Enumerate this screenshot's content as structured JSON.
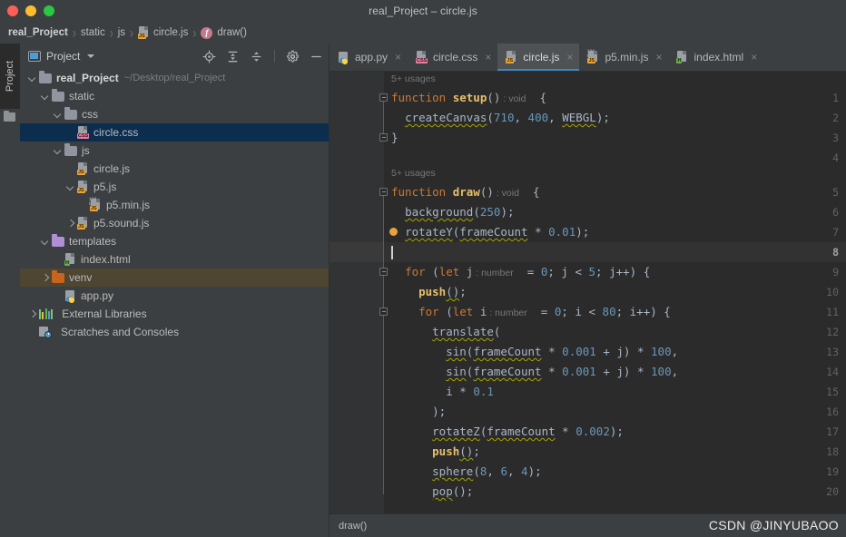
{
  "window": {
    "title": "real_Project – circle.js",
    "traffic_lights": [
      "close",
      "minimize",
      "maximize"
    ]
  },
  "breadcrumb": {
    "separator": "›",
    "items": [
      {
        "label": "real_Project",
        "bold": true,
        "icon": ""
      },
      {
        "label": "static",
        "bold": false,
        "icon": ""
      },
      {
        "label": "js",
        "bold": false,
        "icon": ""
      },
      {
        "label": "circle.js",
        "bold": false,
        "icon": "js-file-icon"
      },
      {
        "label": "draw()",
        "bold": false,
        "icon": "function-badge-icon"
      }
    ]
  },
  "left_strip": {
    "vertical_tab_label": "Project",
    "folder_icon": "folder-icon"
  },
  "project_panel": {
    "title": "Project",
    "title_icon": "project-view-icon",
    "dropdown_icon": "chevron-down-icon",
    "toolbar_icons": [
      "select-opened-file-icon",
      "expand-all-icon",
      "collapse-all-icon",
      "settings-gear-icon",
      "hide-panel-icon"
    ],
    "tree": [
      {
        "depth": 0,
        "chevron": "down",
        "icon": "folder-gray",
        "label": "real_Project",
        "bold": true,
        "path": "~/Desktop/real_Project",
        "state": "normal"
      },
      {
        "depth": 1,
        "chevron": "down",
        "icon": "folder-gray",
        "label": "static",
        "bold": false,
        "path": "",
        "state": "normal"
      },
      {
        "depth": 2,
        "chevron": "down",
        "icon": "folder-gray",
        "label": "css",
        "bold": false,
        "path": "",
        "state": "normal"
      },
      {
        "depth": 3,
        "chevron": "none",
        "icon": "file-css",
        "label": "circle.css",
        "bold": false,
        "path": "",
        "state": "selected"
      },
      {
        "depth": 2,
        "chevron": "down",
        "icon": "folder-gray",
        "label": "js",
        "bold": false,
        "path": "",
        "state": "normal"
      },
      {
        "depth": 3,
        "chevron": "none",
        "icon": "file-js",
        "label": "circle.js",
        "bold": false,
        "path": "",
        "state": "normal"
      },
      {
        "depth": 3,
        "chevron": "down",
        "icon": "file-js",
        "label": "p5.js",
        "bold": false,
        "path": "",
        "state": "normal"
      },
      {
        "depth": 4,
        "chevron": "none",
        "icon": "file-minjs",
        "label": "p5.min.js",
        "bold": false,
        "path": "",
        "state": "normal"
      },
      {
        "depth": 3,
        "chevron": "right",
        "icon": "file-js",
        "label": "p5.sound.js",
        "bold": false,
        "path": "",
        "state": "normal"
      },
      {
        "depth": 1,
        "chevron": "down",
        "icon": "folder-purple",
        "label": "templates",
        "bold": false,
        "path": "",
        "state": "normal"
      },
      {
        "depth": 2,
        "chevron": "none",
        "icon": "file-html",
        "label": "index.html",
        "bold": false,
        "path": "",
        "state": "normal"
      },
      {
        "depth": 1,
        "chevron": "right",
        "icon": "folder-orange",
        "label": "venv",
        "bold": false,
        "path": "",
        "state": "selected-inactive"
      },
      {
        "depth": 2,
        "chevron": "none",
        "icon": "file-python",
        "label": "app.py",
        "bold": false,
        "path": "",
        "state": "normal"
      },
      {
        "depth": 0,
        "chevron": "right",
        "icon": "external-libraries",
        "label": "External Libraries",
        "bold": false,
        "path": "",
        "state": "normal"
      },
      {
        "depth": 0,
        "chevron": "none",
        "icon": "scratches",
        "label": "Scratches and Consoles",
        "bold": false,
        "path": "",
        "state": "normal"
      }
    ]
  },
  "editor": {
    "tabs": [
      {
        "label": "app.py",
        "icon": "python-file-icon",
        "active": false,
        "close_icon": "×"
      },
      {
        "label": "circle.css",
        "icon": "css-file-icon",
        "active": false,
        "close_icon": "×"
      },
      {
        "label": "circle.js",
        "icon": "js-file-icon",
        "active": true,
        "close_icon": "×"
      },
      {
        "label": "p5.min.js",
        "icon": "minjs-file-icon",
        "active": false,
        "close_icon": "×"
      },
      {
        "label": "index.html",
        "icon": "html-file-icon",
        "active": false,
        "close_icon": "×"
      }
    ],
    "usage_hints": [
      {
        "text": "5+ usages",
        "above_line": 1
      },
      {
        "text": "5+ usages",
        "above_line": 5
      }
    ],
    "current_line": 8,
    "breakpoint_line": 7,
    "line_numbers": [
      1,
      2,
      3,
      4,
      5,
      6,
      7,
      8,
      9,
      10,
      11,
      12,
      13,
      14,
      15,
      16,
      17,
      18,
      19,
      20
    ],
    "code": [
      {
        "n": 1,
        "tokens": [
          {
            "t": "function ",
            "c": "kw"
          },
          {
            "t": "setup",
            "c": "fname"
          },
          {
            "t": "()",
            "c": "id"
          },
          {
            "t": " : void",
            "c": "hint"
          },
          {
            "t": "  {",
            "c": "id"
          }
        ]
      },
      {
        "n": 2,
        "tokens": [
          {
            "t": "  ",
            "c": "id"
          },
          {
            "t": "createCanvas",
            "c": "sq"
          },
          {
            "t": "(",
            "c": "id"
          },
          {
            "t": "710",
            "c": "num"
          },
          {
            "t": ", ",
            "c": "id"
          },
          {
            "t": "400",
            "c": "num"
          },
          {
            "t": ", ",
            "c": "id"
          },
          {
            "t": "WEBGL",
            "c": "sq"
          },
          {
            "t": ");",
            "c": "id"
          }
        ]
      },
      {
        "n": 3,
        "tokens": [
          {
            "t": "}",
            "c": "id"
          }
        ]
      },
      {
        "n": 4,
        "tokens": []
      },
      {
        "n": 5,
        "tokens": [
          {
            "t": "function ",
            "c": "kw"
          },
          {
            "t": "draw",
            "c": "fname"
          },
          {
            "t": "()",
            "c": "id"
          },
          {
            "t": " : void",
            "c": "hint"
          },
          {
            "t": "  {",
            "c": "id"
          }
        ]
      },
      {
        "n": 6,
        "tokens": [
          {
            "t": "  ",
            "c": "id"
          },
          {
            "t": "background",
            "c": "sq"
          },
          {
            "t": "(",
            "c": "id"
          },
          {
            "t": "250",
            "c": "num"
          },
          {
            "t": ");",
            "c": "id"
          }
        ]
      },
      {
        "n": 7,
        "tokens": [
          {
            "t": "  ",
            "c": "id"
          },
          {
            "t": "rotateY",
            "c": "sq"
          },
          {
            "t": "(",
            "c": "id"
          },
          {
            "t": "frameCount",
            "c": "sq"
          },
          {
            "t": " * ",
            "c": "id"
          },
          {
            "t": "0.01",
            "c": "num"
          },
          {
            "t": ");",
            "c": "id"
          }
        ]
      },
      {
        "n": 8,
        "tokens": []
      },
      {
        "n": 9,
        "tokens": [
          {
            "t": "  ",
            "c": "id"
          },
          {
            "t": "for ",
            "c": "kw"
          },
          {
            "t": "(",
            "c": "id"
          },
          {
            "t": "let",
            "c": "kw"
          },
          {
            "t": " j",
            "c": "id"
          },
          {
            "t": " : number",
            "c": "hint"
          },
          {
            "t": "  = ",
            "c": "id"
          },
          {
            "t": "0",
            "c": "num"
          },
          {
            "t": "; j < ",
            "c": "id"
          },
          {
            "t": "5",
            "c": "num"
          },
          {
            "t": "; j++) {",
            "c": "id"
          }
        ]
      },
      {
        "n": 10,
        "tokens": [
          {
            "t": "    ",
            "c": "id"
          },
          {
            "t": "push",
            "c": "fname"
          },
          {
            "t": "()",
            "c": "sq"
          },
          {
            "t": ";",
            "c": "id"
          }
        ]
      },
      {
        "n": 11,
        "tokens": [
          {
            "t": "    ",
            "c": "id"
          },
          {
            "t": "for ",
            "c": "kw"
          },
          {
            "t": "(",
            "c": "id"
          },
          {
            "t": "let",
            "c": "kw"
          },
          {
            "t": " i",
            "c": "id"
          },
          {
            "t": " : number",
            "c": "hint"
          },
          {
            "t": "  = ",
            "c": "id"
          },
          {
            "t": "0",
            "c": "num"
          },
          {
            "t": "; i < ",
            "c": "id"
          },
          {
            "t": "80",
            "c": "num"
          },
          {
            "t": "; i++) {",
            "c": "id"
          }
        ]
      },
      {
        "n": 12,
        "tokens": [
          {
            "t": "      ",
            "c": "id"
          },
          {
            "t": "translate",
            "c": "sq"
          },
          {
            "t": "(",
            "c": "id"
          }
        ]
      },
      {
        "n": 13,
        "tokens": [
          {
            "t": "        ",
            "c": "id"
          },
          {
            "t": "sin",
            "c": "sq"
          },
          {
            "t": "(",
            "c": "id"
          },
          {
            "t": "frameCount",
            "c": "sq"
          },
          {
            "t": " * ",
            "c": "id"
          },
          {
            "t": "0.001",
            "c": "num"
          },
          {
            "t": " + j) * ",
            "c": "id"
          },
          {
            "t": "100",
            "c": "num"
          },
          {
            "t": ",",
            "c": "id"
          }
        ]
      },
      {
        "n": 14,
        "tokens": [
          {
            "t": "        ",
            "c": "id"
          },
          {
            "t": "sin",
            "c": "sq"
          },
          {
            "t": "(",
            "c": "id"
          },
          {
            "t": "frameCount",
            "c": "sq"
          },
          {
            "t": " * ",
            "c": "id"
          },
          {
            "t": "0.001",
            "c": "num"
          },
          {
            "t": " + j) * ",
            "c": "id"
          },
          {
            "t": "100",
            "c": "num"
          },
          {
            "t": ",",
            "c": "id"
          }
        ]
      },
      {
        "n": 15,
        "tokens": [
          {
            "t": "        i * ",
            "c": "id"
          },
          {
            "t": "0.1",
            "c": "num"
          }
        ]
      },
      {
        "n": 16,
        "tokens": [
          {
            "t": "      );",
            "c": "id"
          }
        ]
      },
      {
        "n": 17,
        "tokens": [
          {
            "t": "      ",
            "c": "id"
          },
          {
            "t": "rotateZ",
            "c": "sq"
          },
          {
            "t": "(",
            "c": "id"
          },
          {
            "t": "frameCount",
            "c": "sq"
          },
          {
            "t": " * ",
            "c": "id"
          },
          {
            "t": "0.002",
            "c": "num"
          },
          {
            "t": ");",
            "c": "id"
          }
        ]
      },
      {
        "n": 18,
        "tokens": [
          {
            "t": "      ",
            "c": "id"
          },
          {
            "t": "push",
            "c": "fname"
          },
          {
            "t": "()",
            "c": "sq"
          },
          {
            "t": ";",
            "c": "id"
          }
        ]
      },
      {
        "n": 19,
        "tokens": [
          {
            "t": "      ",
            "c": "id"
          },
          {
            "t": "sphere",
            "c": "sq"
          },
          {
            "t": "(",
            "c": "id"
          },
          {
            "t": "8",
            "c": "num"
          },
          {
            "t": ", ",
            "c": "id"
          },
          {
            "t": "6",
            "c": "num"
          },
          {
            "t": ", ",
            "c": "id"
          },
          {
            "t": "4",
            "c": "num"
          },
          {
            "t": ");",
            "c": "id"
          }
        ]
      },
      {
        "n": 20,
        "tokens": [
          {
            "t": "      ",
            "c": "id"
          },
          {
            "t": "pop",
            "c": "sq"
          },
          {
            "t": "();",
            "c": "id"
          }
        ]
      }
    ]
  },
  "status_bar": {
    "text": "draw()"
  },
  "watermark": {
    "text": "CSDN @JINYUBAOO"
  },
  "colors": {
    "accent_blue": "#4086C7",
    "keyword_orange": "#CC7832",
    "function_yellow": "#E8BF6A",
    "number_blue": "#6897BB",
    "editor_bg": "#2B2B2B",
    "panel_bg": "#3C3F41",
    "selection_blue": "#0D2D4E",
    "selection_inactive": "#4E4631"
  }
}
